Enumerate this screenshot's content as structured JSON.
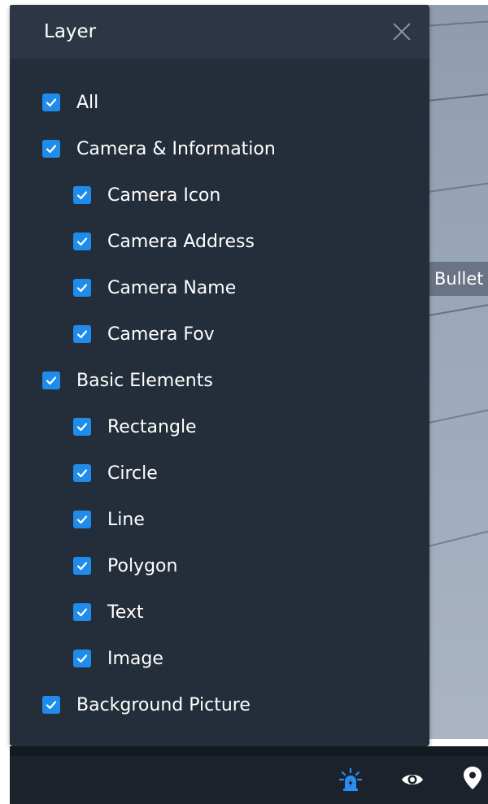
{
  "panel": {
    "title": "Layer"
  },
  "background": {
    "tag_label": "Bullet"
  },
  "layers": [
    {
      "label": "All",
      "checked": true,
      "level": 0
    },
    {
      "label": "Camera & Information",
      "checked": true,
      "level": 0
    },
    {
      "label": "Camera Icon",
      "checked": true,
      "level": 1
    },
    {
      "label": "Camera Address",
      "checked": true,
      "level": 1
    },
    {
      "label": "Camera Name",
      "checked": true,
      "level": 1
    },
    {
      "label": "Camera Fov",
      "checked": true,
      "level": 1
    },
    {
      "label": "Basic Elements",
      "checked": true,
      "level": 0
    },
    {
      "label": "Rectangle",
      "checked": true,
      "level": 1
    },
    {
      "label": "Circle",
      "checked": true,
      "level": 1
    },
    {
      "label": "Line",
      "checked": true,
      "level": 1
    },
    {
      "label": "Polygon",
      "checked": true,
      "level": 1
    },
    {
      "label": "Text",
      "checked": true,
      "level": 1
    },
    {
      "label": "Image",
      "checked": true,
      "level": 1
    },
    {
      "label": "Background Picture",
      "checked": true,
      "level": 0
    }
  ],
  "toolbar": {
    "icons": [
      "alarm-light-icon",
      "eye-icon",
      "location-pin-icon"
    ]
  },
  "colors": {
    "panel_bg": "#242d3a",
    "header_bg": "#2d3644",
    "checkbox": "#1f8cec",
    "alarm_icon": "#2a8df0",
    "toolbar_bg": "#1c222c"
  }
}
